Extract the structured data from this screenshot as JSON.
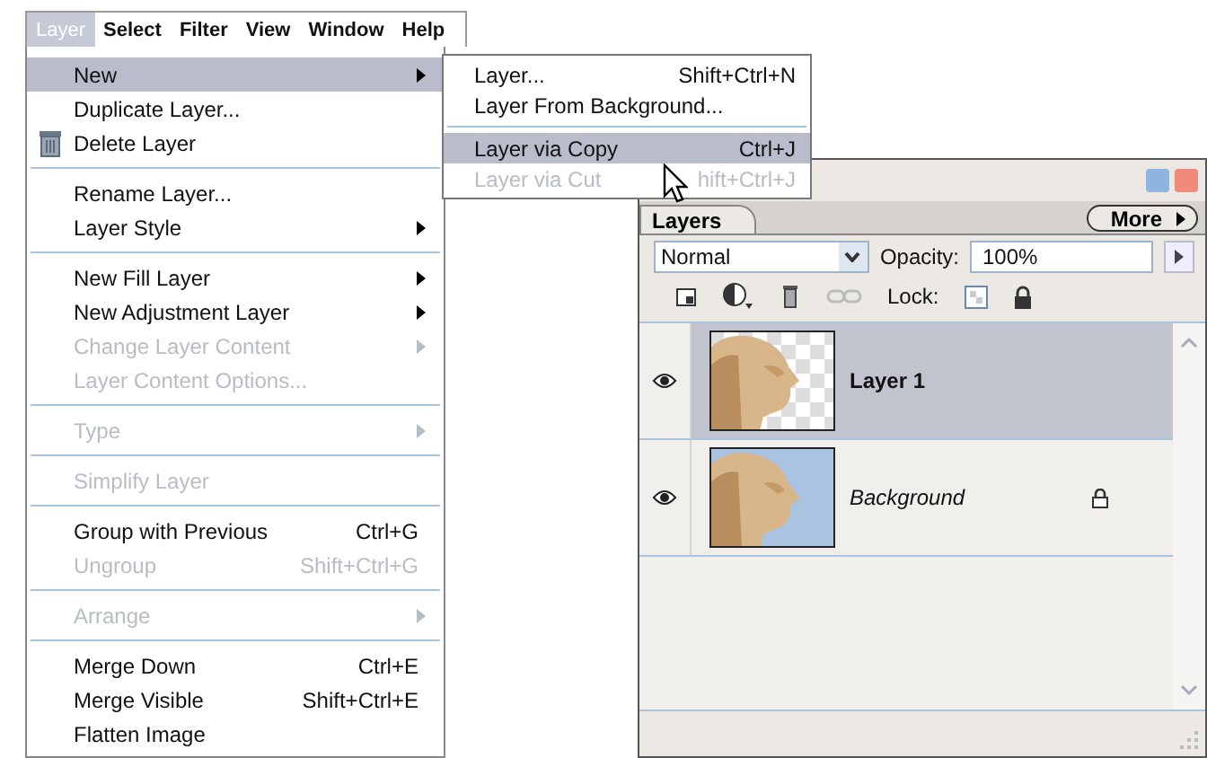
{
  "menu_bar": [
    {
      "label": "Layer",
      "selected": true
    },
    {
      "label": "Select",
      "selected": false
    },
    {
      "label": "Filter",
      "selected": false
    },
    {
      "label": "View",
      "selected": false
    },
    {
      "label": "Window",
      "selected": false
    },
    {
      "label": "Help",
      "selected": false
    }
  ],
  "menu": [
    [
      {
        "label": "New",
        "submenu": true,
        "disabled": false,
        "selected": true
      },
      {
        "label": "Duplicate Layer...",
        "submenu": false,
        "disabled": false,
        "selected": false
      },
      {
        "label": "Delete Layer",
        "submenu": false,
        "disabled": false,
        "selected": false,
        "kind": "trash"
      }
    ],
    [
      {
        "label": "Rename Layer...",
        "submenu": false,
        "disabled": false,
        "selected": false
      },
      {
        "label": "Layer Style",
        "submenu": true,
        "disabled": false,
        "selected": false
      }
    ],
    [
      {
        "label": "New Fill Layer",
        "submenu": true,
        "disabled": false,
        "selected": false
      },
      {
        "label": "New Adjustment Layer",
        "submenu": true,
        "disabled": false,
        "selected": false
      },
      {
        "label": "Change Layer Content",
        "submenu": true,
        "disabled": true,
        "selected": false
      },
      {
        "label": "Layer Content Options...",
        "submenu": false,
        "disabled": true,
        "selected": false
      }
    ],
    [
      {
        "label": "Type",
        "submenu": true,
        "disabled": true,
        "selected": false
      }
    ],
    [
      {
        "label": "Simplify Layer",
        "submenu": false,
        "disabled": true,
        "selected": false
      }
    ],
    [
      {
        "label": "Group with Previous",
        "shortcut": "Ctrl+G",
        "submenu": false,
        "disabled": false,
        "selected": false
      },
      {
        "label": "Ungroup",
        "shortcut": "Shift+Ctrl+G",
        "submenu": false,
        "disabled": true,
        "selected": false
      }
    ],
    [
      {
        "label": "Arrange",
        "submenu": true,
        "disabled": true,
        "selected": false
      }
    ],
    [
      {
        "label": "Merge Down",
        "shortcut": "Ctrl+E",
        "submenu": false,
        "disabled": false,
        "selected": false
      },
      {
        "label": "Merge Visible",
        "shortcut": "Shift+Ctrl+E",
        "submenu": false,
        "disabled": false,
        "selected": false
      },
      {
        "label": "Flatten Image",
        "submenu": false,
        "disabled": false,
        "selected": false
      }
    ]
  ],
  "submenu": [
    [
      {
        "label": "Layer...",
        "shortcut": "Shift+Ctrl+N",
        "disabled": false,
        "selected": false
      },
      {
        "label": "Layer From Background...",
        "disabled": false,
        "selected": false
      }
    ],
    [
      {
        "label": "Layer via Copy",
        "shortcut": "Ctrl+J",
        "disabled": false,
        "selected": true
      },
      {
        "label": "Layer via Cut",
        "shortcut": "hift+Ctrl+J",
        "disabled": true,
        "selected": false
      }
    ]
  ],
  "layers_palette": {
    "tab": "Layers",
    "more_button": "More",
    "blend_mode": "Normal",
    "opacity_label": "Opacity:",
    "opacity": "100%",
    "lock_label": "Lock:",
    "layers": [
      {
        "name": "Layer 1",
        "visible": true,
        "selected": true,
        "locked": false,
        "transparent": true,
        "italic": false
      },
      {
        "name": "Background",
        "visible": true,
        "selected": false,
        "locked": true,
        "transparent": false,
        "italic": true
      }
    ]
  }
}
